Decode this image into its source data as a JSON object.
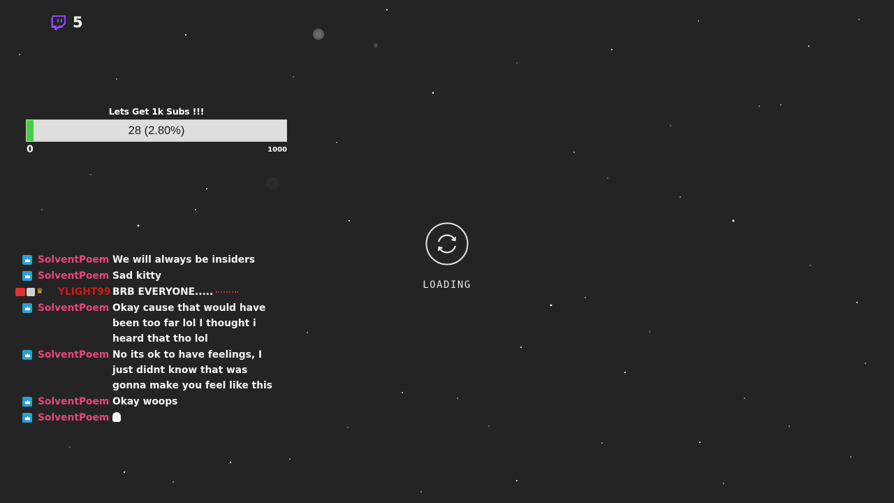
{
  "viewers": {
    "count": "5",
    "icon": "twitch-glitch-icon",
    "color": "#9146ff"
  },
  "sub_goal": {
    "title": "Lets Get 1k Subs !!!",
    "current": 28,
    "target": 1000,
    "progress_text": "28 (2.80%)",
    "progress_fraction": 0.028,
    "min_label": "0",
    "max_label": "1000",
    "fill_color": "#43d143"
  },
  "chat": {
    "messages": [
      {
        "user": "SolventPoem",
        "text": "We will always be insiders",
        "badges": [
          "crown-badge"
        ]
      },
      {
        "user": "SolventPoem",
        "text": "Sad kitty",
        "badges": [
          "crown-badge"
        ]
      },
      {
        "user": "YLIGHT99",
        "text": "BRB EVERYONE.....",
        "badges": [
          "video-badge",
          "sub-badge",
          "crown-gold-badge"
        ],
        "highlight": true
      },
      {
        "user": "SolventPoem",
        "text": "Okay cause that would have been too far lol I thought i heard that tho lol",
        "badges": [
          "crown-badge"
        ]
      },
      {
        "user": "SolventPoem",
        "text": "No its ok to have feelings, I just didnt know that was gonna make you feel like this",
        "badges": [
          "crown-badge"
        ]
      },
      {
        "user": "SolventPoem",
        "text": "Okay woops",
        "badges": [
          "crown-badge"
        ]
      },
      {
        "user": "SolventPoem",
        "text": "",
        "badges": [
          "crown-badge"
        ],
        "emote": "ghost-emote"
      }
    ],
    "user_color": "#e8467c"
  },
  "loading": {
    "text": "LOADING",
    "icon": "refresh-icon"
  }
}
